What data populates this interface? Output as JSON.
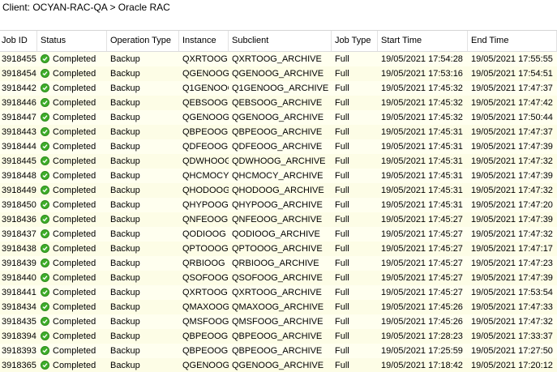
{
  "breadcrumb": "Client: OCYAN-RAC-QA > Oracle RAC",
  "columns": [
    "Job ID",
    "Status",
    "Operation Type",
    "Instance",
    "Subclient",
    "Job Type",
    "Start Time",
    "End Time"
  ],
  "rows": [
    {
      "job_id": "3918455",
      "status": "Completed",
      "operation": "Backup",
      "instance": "QXRTOOG",
      "subclient": "QXRTOOG_ARCHIVE",
      "job_type": "Full",
      "start": "19/05/2021 17:54:28",
      "end": "19/05/2021 17:55:55"
    },
    {
      "job_id": "3918454",
      "status": "Completed",
      "operation": "Backup",
      "instance": "QGENOOG",
      "subclient": "QGENOOG_ARCHIVE",
      "job_type": "Full",
      "start": "19/05/2021 17:53:16",
      "end": "19/05/2021 17:54:51"
    },
    {
      "job_id": "3918442",
      "status": "Completed",
      "operation": "Backup",
      "instance": "Q1GENOOG",
      "subclient": "Q1GENOOG_ARCHIVE",
      "job_type": "Full",
      "start": "19/05/2021 17:45:32",
      "end": "19/05/2021 17:47:37"
    },
    {
      "job_id": "3918446",
      "status": "Completed",
      "operation": "Backup",
      "instance": "QEBSOOG",
      "subclient": "QEBSOOG_ARCHIVE",
      "job_type": "Full",
      "start": "19/05/2021 17:45:32",
      "end": "19/05/2021 17:47:42"
    },
    {
      "job_id": "3918447",
      "status": "Completed",
      "operation": "Backup",
      "instance": "QGENOOG",
      "subclient": "QGENOOG_ARCHIVE",
      "job_type": "Full",
      "start": "19/05/2021 17:45:32",
      "end": "19/05/2021 17:50:44"
    },
    {
      "job_id": "3918443",
      "status": "Completed",
      "operation": "Backup",
      "instance": "QBPEOOG",
      "subclient": "QBPEOOG_ARCHIVE",
      "job_type": "Full",
      "start": "19/05/2021 17:45:31",
      "end": "19/05/2021 17:47:37"
    },
    {
      "job_id": "3918444",
      "status": "Completed",
      "operation": "Backup",
      "instance": "QDFEOOG",
      "subclient": "QDFEOOG_ARCHIVE",
      "job_type": "Full",
      "start": "19/05/2021 17:45:31",
      "end": "19/05/2021 17:47:39"
    },
    {
      "job_id": "3918445",
      "status": "Completed",
      "operation": "Backup",
      "instance": "QDWHOOG",
      "subclient": "QDWHOOG_ARCHIVE",
      "job_type": "Full",
      "start": "19/05/2021 17:45:31",
      "end": "19/05/2021 17:47:32"
    },
    {
      "job_id": "3918448",
      "status": "Completed",
      "operation": "Backup",
      "instance": "QHCMOCY",
      "subclient": "QHCMOCY_ARCHIVE",
      "job_type": "Full",
      "start": "19/05/2021 17:45:31",
      "end": "19/05/2021 17:47:39"
    },
    {
      "job_id": "3918449",
      "status": "Completed",
      "operation": "Backup",
      "instance": "QHODOOG",
      "subclient": "QHODOOG_ARCHIVE",
      "job_type": "Full",
      "start": "19/05/2021 17:45:31",
      "end": "19/05/2021 17:47:32"
    },
    {
      "job_id": "3918450",
      "status": "Completed",
      "operation": "Backup",
      "instance": "QHYPOOG",
      "subclient": "QHYPOOG_ARCHIVE",
      "job_type": "Full",
      "start": "19/05/2021 17:45:31",
      "end": "19/05/2021 17:47:20"
    },
    {
      "job_id": "3918436",
      "status": "Completed",
      "operation": "Backup",
      "instance": "QNFEOOG",
      "subclient": "QNFEOOG_ARCHIVE",
      "job_type": "Full",
      "start": "19/05/2021 17:45:27",
      "end": "19/05/2021 17:47:39"
    },
    {
      "job_id": "3918437",
      "status": "Completed",
      "operation": "Backup",
      "instance": "QODIOOG",
      "subclient": "QODIOOG_ARCHIVE",
      "job_type": "Full",
      "start": "19/05/2021 17:45:27",
      "end": "19/05/2021 17:47:32"
    },
    {
      "job_id": "3918438",
      "status": "Completed",
      "operation": "Backup",
      "instance": "QPTOOOG",
      "subclient": "QPTOOOG_ARCHIVE",
      "job_type": "Full",
      "start": "19/05/2021 17:45:27",
      "end": "19/05/2021 17:47:17"
    },
    {
      "job_id": "3918439",
      "status": "Completed",
      "operation": "Backup",
      "instance": "QRBIOOG",
      "subclient": "QRBIOOG_ARCHIVE",
      "job_type": "Full",
      "start": "19/05/2021 17:45:27",
      "end": "19/05/2021 17:47:23"
    },
    {
      "job_id": "3918440",
      "status": "Completed",
      "operation": "Backup",
      "instance": "QSOFOOG",
      "subclient": "QSOFOOG_ARCHIVE",
      "job_type": "Full",
      "start": "19/05/2021 17:45:27",
      "end": "19/05/2021 17:47:39"
    },
    {
      "job_id": "3918441",
      "status": "Completed",
      "operation": "Backup",
      "instance": "QXRTOOG",
      "subclient": "QXRTOOG_ARCHIVE",
      "job_type": "Full",
      "start": "19/05/2021 17:45:27",
      "end": "19/05/2021 17:53:54"
    },
    {
      "job_id": "3918434",
      "status": "Completed",
      "operation": "Backup",
      "instance": "QMAXOOG",
      "subclient": "QMAXOOG_ARCHIVE",
      "job_type": "Full",
      "start": "19/05/2021 17:45:26",
      "end": "19/05/2021 17:47:33"
    },
    {
      "job_id": "3918435",
      "status": "Completed",
      "operation": "Backup",
      "instance": "QMSFOOG",
      "subclient": "QMSFOOG_ARCHIVE",
      "job_type": "Full",
      "start": "19/05/2021 17:45:26",
      "end": "19/05/2021 17:47:32"
    },
    {
      "job_id": "3918394",
      "status": "Completed",
      "operation": "Backup",
      "instance": "QBPEOOG",
      "subclient": "QBPEOOG_ARCHIVE",
      "job_type": "Full",
      "start": "19/05/2021 17:28:23",
      "end": "19/05/2021 17:33:37"
    },
    {
      "job_id": "3918393",
      "status": "Completed",
      "operation": "Backup",
      "instance": "QBPEOOG",
      "subclient": "QBPEOOG_ARCHIVE",
      "job_type": "Full",
      "start": "19/05/2021 17:25:59",
      "end": "19/05/2021 17:27:50"
    },
    {
      "job_id": "3918365",
      "status": "Completed",
      "operation": "Backup",
      "instance": "QGENOOG",
      "subclient": "QGENOOG_ARCHIVE",
      "job_type": "Full",
      "start": "19/05/2021 17:18:42",
      "end": "19/05/2021 17:20:12"
    }
  ],
  "colors": {
    "row_bg": "#ffffef",
    "status_ok": "#3fae2a"
  },
  "icons": {
    "status": "check-circle-icon"
  }
}
